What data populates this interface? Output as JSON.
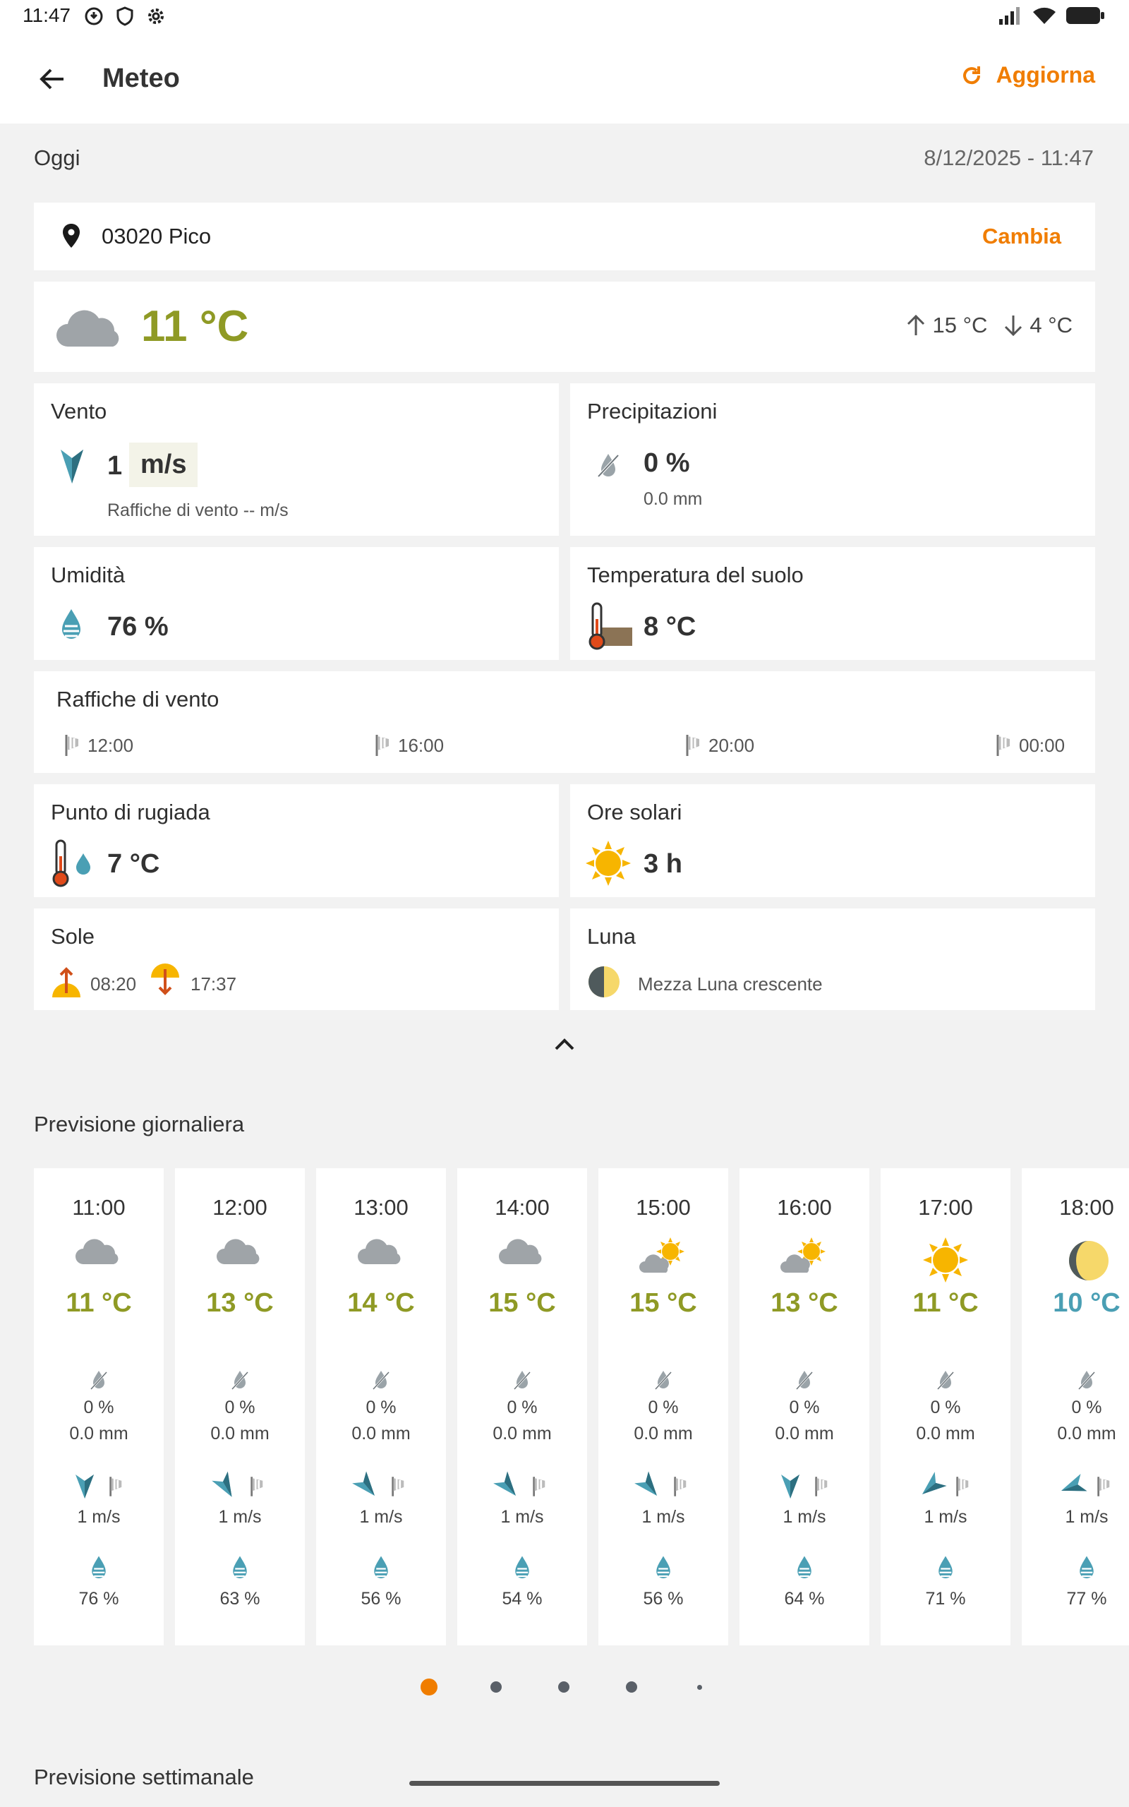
{
  "status": {
    "time": "11:47"
  },
  "app": {
    "title": "Meteo",
    "refresh_label": "Aggiorna"
  },
  "today": {
    "label": "Oggi",
    "datetime": "8/12/2025 - 11:47"
  },
  "location": {
    "name": "03020 Pico",
    "change_label": "Cambia"
  },
  "current": {
    "temperature": "11 °C",
    "max": "15 °C",
    "min": "4 °C",
    "icon": "cloud-icon"
  },
  "wind": {
    "title": "Vento",
    "value": "1",
    "unit": "m/s",
    "gust_text": "Raffiche di vento -- m/s"
  },
  "precipitation": {
    "title": "Precipitazioni",
    "value": "0 %",
    "amount": "0.0 mm"
  },
  "humidity": {
    "title": "Umidità",
    "value": "76 %"
  },
  "soil": {
    "title": "Temperatura del suolo",
    "value": "8 °C"
  },
  "gusts": {
    "title": "Raffiche di vento",
    "times": [
      "12:00",
      "16:00",
      "20:00",
      "00:00"
    ]
  },
  "dew": {
    "title": "Punto di rugiada",
    "value": "7 °C"
  },
  "sun_hours": {
    "title": "Ore solari",
    "value": "3 h"
  },
  "sun": {
    "title": "Sole",
    "sunrise": "08:20",
    "sunset": "17:37"
  },
  "moon": {
    "title": "Luna",
    "phase": "Mezza Luna crescente"
  },
  "daily": {
    "title": "Previsione giornaliera",
    "hours": [
      {
        "time": "11:00",
        "icon": "cloud",
        "temp": "11 °C",
        "rain_pct": "0 %",
        "rain_mm": "0.0 mm",
        "wind": "1 m/s",
        "wind_dir": 180,
        "humidity": "76 %"
      },
      {
        "time": "12:00",
        "icon": "cloud",
        "temp": "13 °C",
        "rain_pct": "0 %",
        "rain_mm": "0.0 mm",
        "wind": "1 m/s",
        "wind_dir": 150,
        "humidity": "63 %"
      },
      {
        "time": "13:00",
        "icon": "cloud",
        "temp": "14 °C",
        "rain_pct": "0 %",
        "rain_mm": "0.0 mm",
        "wind": "1 m/s",
        "wind_dir": 140,
        "humidity": "56 %"
      },
      {
        "time": "14:00",
        "icon": "cloud",
        "temp": "15 °C",
        "rain_pct": "0 %",
        "rain_mm": "0.0 mm",
        "wind": "1 m/s",
        "wind_dir": 140,
        "humidity": "54 %"
      },
      {
        "time": "15:00",
        "icon": "sun-cloud",
        "temp": "15 °C",
        "rain_pct": "0 %",
        "rain_mm": "0.0 mm",
        "wind": "1 m/s",
        "wind_dir": 140,
        "humidity": "56 %"
      },
      {
        "time": "16:00",
        "icon": "sun-cloud",
        "temp": "13 °C",
        "rain_pct": "0 %",
        "rain_mm": "0.0 mm",
        "wind": "1 m/s",
        "wind_dir": 180,
        "humidity": "64 %"
      },
      {
        "time": "17:00",
        "icon": "sun",
        "temp": "11 °C",
        "rain_pct": "0 %",
        "rain_mm": "0.0 mm",
        "wind": "1 m/s",
        "wind_dir": 230,
        "humidity": "71 %"
      },
      {
        "time": "18:00",
        "icon": "moon",
        "temp": "10 °C",
        "rain_pct": "0 %",
        "rain_mm": "0.0 mm",
        "wind": "1 m/s",
        "wind_dir": 250,
        "humidity": "77 %"
      }
    ]
  },
  "weekly": {
    "title": "Previsione settimanale"
  },
  "colors": {
    "accent": "#f07d00",
    "temp_warm": "#8f9a25",
    "temp_cool": "#4a9fb4",
    "water": "#4a9fb4",
    "sun": "#f7b500"
  }
}
